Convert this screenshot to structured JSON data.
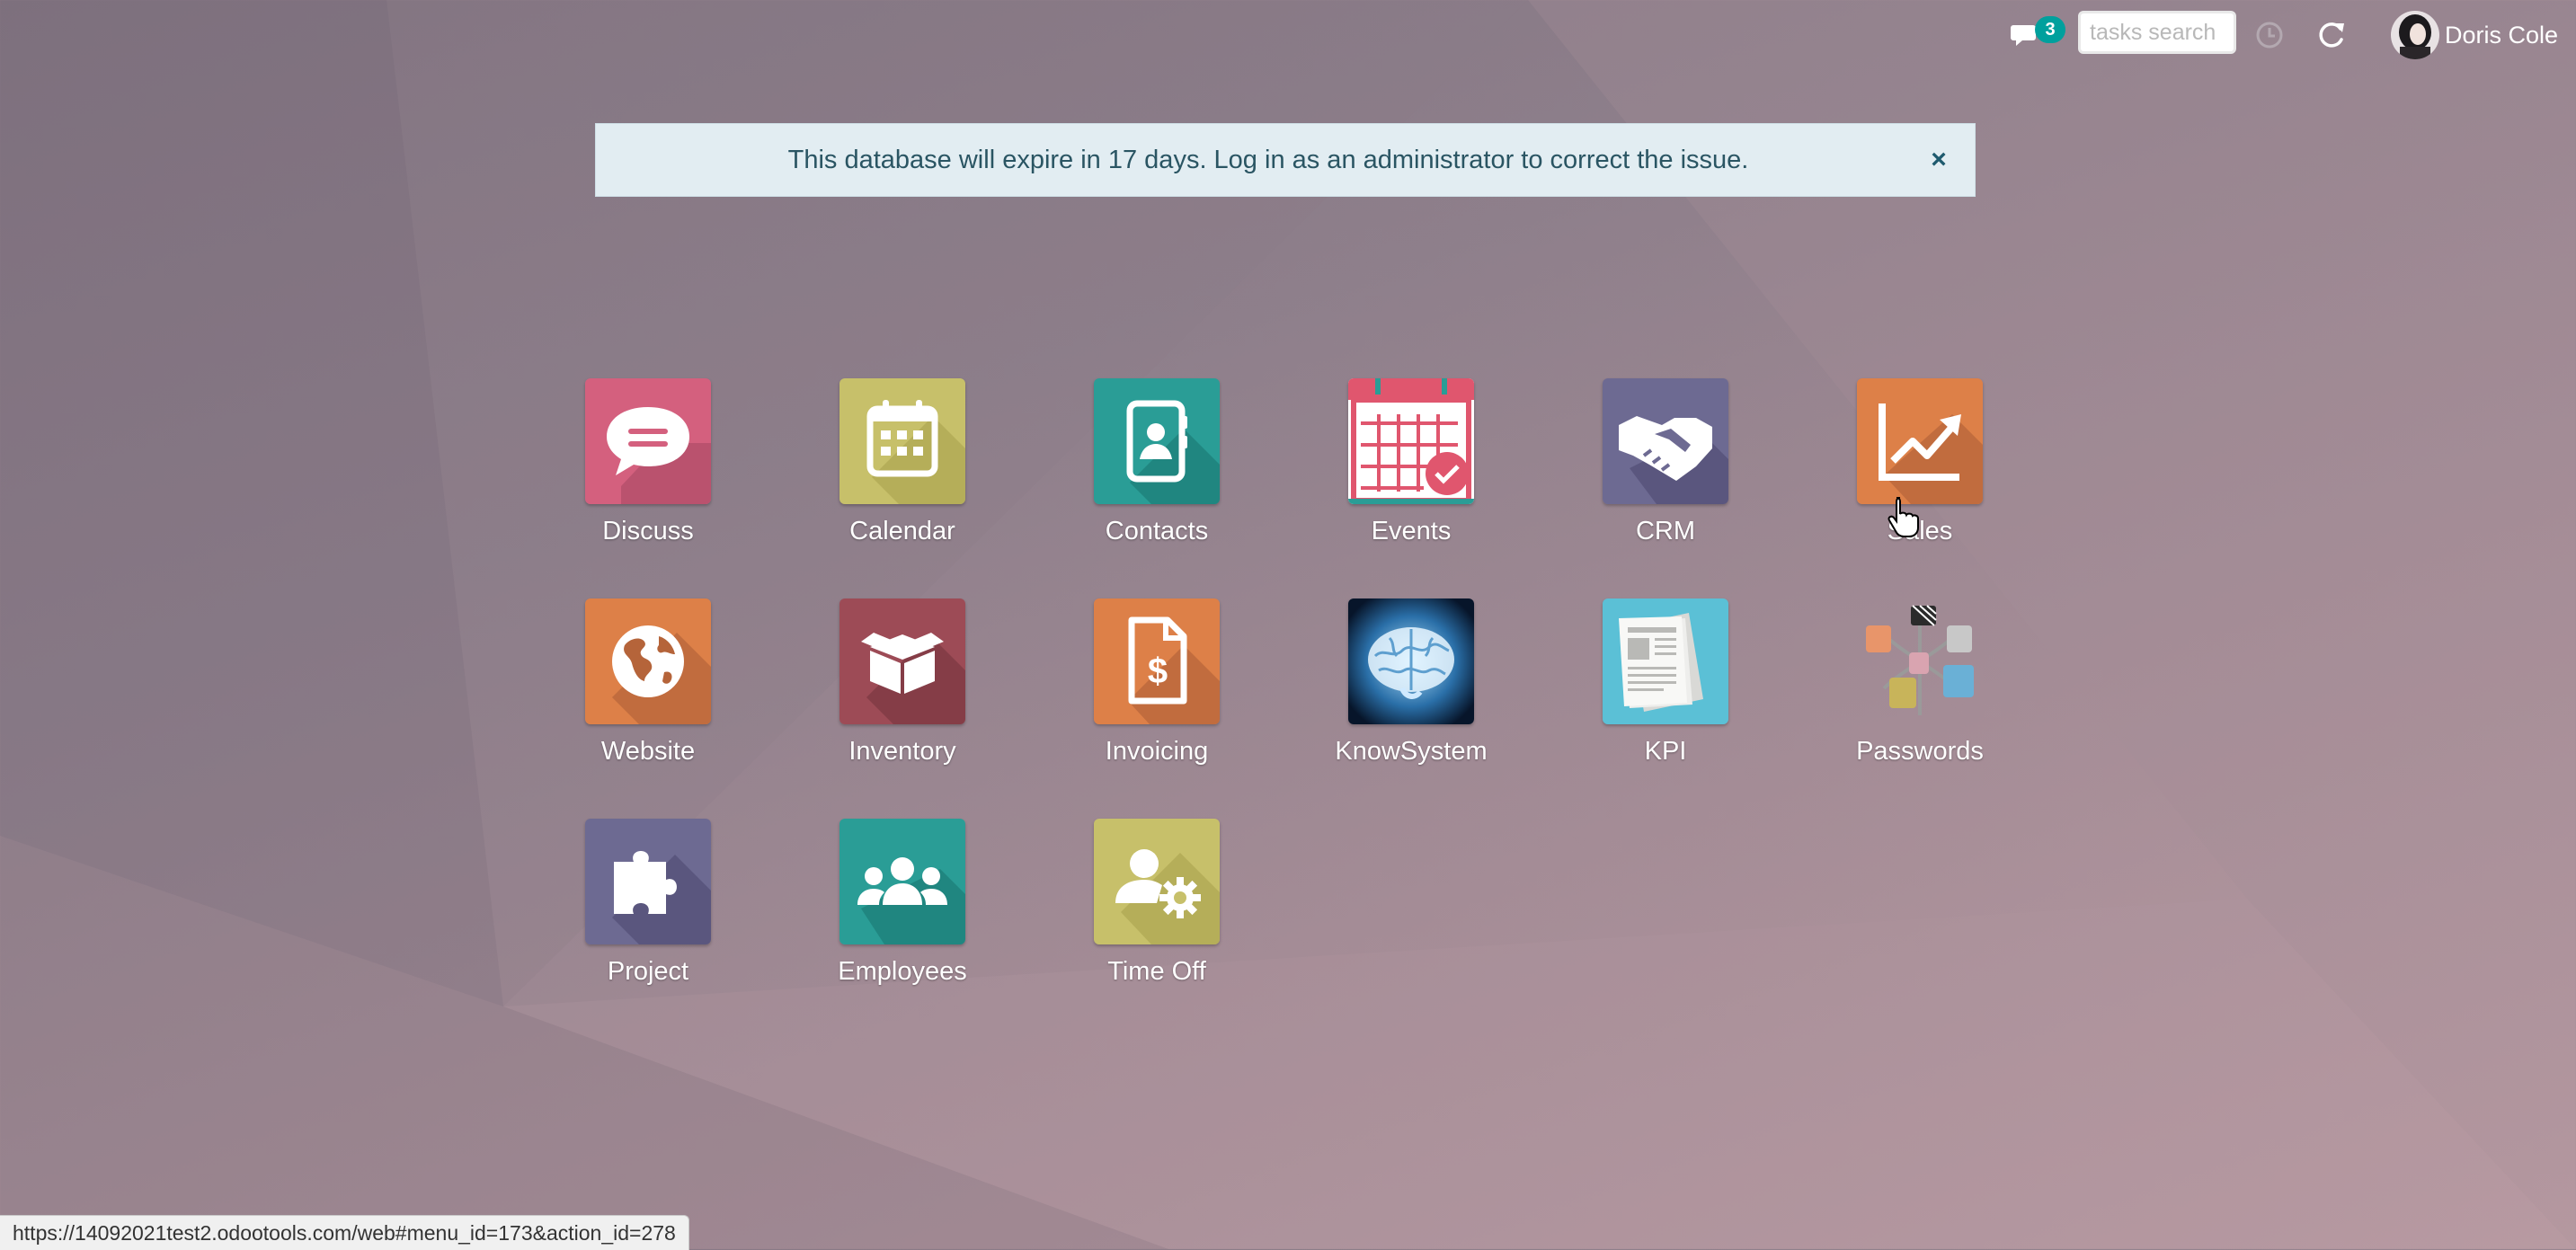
{
  "topbar": {
    "chat_badge": "3",
    "search_placeholder": "tasks search",
    "user_name": "Doris Cole"
  },
  "alert": {
    "text": "This database will expire in 17 days. Log in as an administrator to correct the issue.",
    "close": "×"
  },
  "apps": [
    {
      "label": "Discuss"
    },
    {
      "label": "Calendar"
    },
    {
      "label": "Contacts"
    },
    {
      "label": "Events"
    },
    {
      "label": "CRM"
    },
    {
      "label": "Sales"
    },
    {
      "label": "Website"
    },
    {
      "label": "Inventory"
    },
    {
      "label": "Invoicing"
    },
    {
      "label": "KnowSystem"
    },
    {
      "label": "KPI"
    },
    {
      "label": "Passwords"
    },
    {
      "label": "Project"
    },
    {
      "label": "Employees"
    },
    {
      "label": "Time Off"
    }
  ],
  "statusbar": {
    "url": "https://14092021test2.odootools.com/web#menu_id=173&action_id=278"
  },
  "colors": {
    "discuss": "#d4607e",
    "calendar": "#c7c06a",
    "contacts": "#2a9d96",
    "events_accent": "#e0566e",
    "crm": "#6d6a92",
    "sales": "#dd8048",
    "website": "#dd8048",
    "inventory": "#9d4b56",
    "invoicing": "#dd8048",
    "kpi": "#5bc0d6",
    "project": "#6d6a92",
    "employees": "#2a9d96",
    "timeoff": "#c7c06a",
    "badge": "#00a09d"
  }
}
